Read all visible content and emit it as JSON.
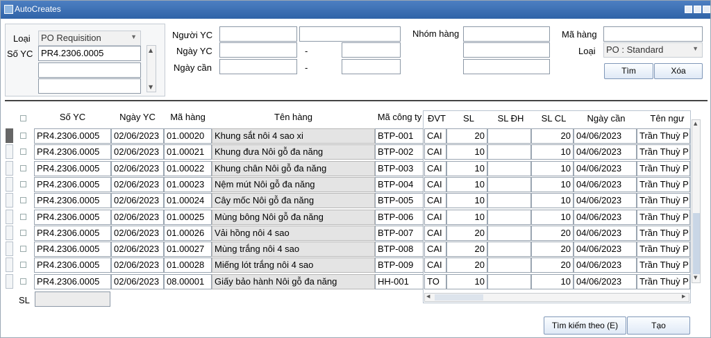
{
  "window": {
    "title": "AutoCreates"
  },
  "search": {
    "loai_label": "Loại",
    "loai_value": "PO Requisition",
    "so_yc_label": "Số YC",
    "so_yc_value": "PR4.2306.0005",
    "nguoi_yc_label": "Người YC",
    "ngay_yc_label": "Ngày YC",
    "ngay_can_label": "Ngày cần",
    "dash": "-",
    "nhom_hang_label": "Nhóm hàng",
    "ma_hang_label": "Mã hàng",
    "loai2_label": "Loại",
    "loai2_value": "PO : Standard",
    "tim_label": "Tìm",
    "xoa_label": "Xóa"
  },
  "table": {
    "columns": [
      "Số YC",
      "Ngày YC",
      "Mã hàng",
      "Tên hàng",
      "Mã công ty",
      "ĐVT",
      "SL",
      "SL ĐH",
      "SL CL",
      "Ngày cần",
      "Tên ngư"
    ],
    "rows": [
      {
        "so_yc": "PR4.2306.0005",
        "ngay_yc": "02/06/2023",
        "ma_hang": "01.00020",
        "ten_hang": "Khung sắt nôi 4 sao xi",
        "ma_cty": "BTP-001",
        "dvt": "CAI",
        "sl": "20",
        "sl_dh": "",
        "sl_cl": "20",
        "ngay_can": "04/06/2023",
        "ten_ngu": "Trần Thuỳ P"
      },
      {
        "so_yc": "PR4.2306.0005",
        "ngay_yc": "02/06/2023",
        "ma_hang": "01.00021",
        "ten_hang": "Khung đưa Nôi gỗ đa năng",
        "ma_cty": "BTP-002",
        "dvt": "CAI",
        "sl": "10",
        "sl_dh": "",
        "sl_cl": "10",
        "ngay_can": "04/06/2023",
        "ten_ngu": "Trần Thuỳ P"
      },
      {
        "so_yc": "PR4.2306.0005",
        "ngay_yc": "02/06/2023",
        "ma_hang": "01.00022",
        "ten_hang": "Khung chân Nôi gỗ đa năng",
        "ma_cty": "BTP-003",
        "dvt": "CAI",
        "sl": "10",
        "sl_dh": "",
        "sl_cl": "10",
        "ngay_can": "04/06/2023",
        "ten_ngu": "Trần Thuỳ P"
      },
      {
        "so_yc": "PR4.2306.0005",
        "ngay_yc": "02/06/2023",
        "ma_hang": "01.00023",
        "ten_hang": "Nệm mút Nôi gỗ đa năng",
        "ma_cty": "BTP-004",
        "dvt": "CAI",
        "sl": "10",
        "sl_dh": "",
        "sl_cl": "10",
        "ngay_can": "04/06/2023",
        "ten_ngu": "Trần Thuỳ P"
      },
      {
        "so_yc": "PR4.2306.0005",
        "ngay_yc": "02/06/2023",
        "ma_hang": "01.00024",
        "ten_hang": "Cây mốc Nôi gỗ đa năng",
        "ma_cty": "BTP-005",
        "dvt": "CAI",
        "sl": "10",
        "sl_dh": "",
        "sl_cl": "10",
        "ngay_can": "04/06/2023",
        "ten_ngu": "Trần Thuỳ P"
      },
      {
        "so_yc": "PR4.2306.0005",
        "ngay_yc": "02/06/2023",
        "ma_hang": "01.00025",
        "ten_hang": "Mùng bông Nôi gỗ đa năng",
        "ma_cty": "BTP-006",
        "dvt": "CAI",
        "sl": "10",
        "sl_dh": "",
        "sl_cl": "10",
        "ngay_can": "04/06/2023",
        "ten_ngu": "Trần Thuỳ P"
      },
      {
        "so_yc": "PR4.2306.0005",
        "ngay_yc": "02/06/2023",
        "ma_hang": "01.00026",
        "ten_hang": "Vải hồng nôi 4 sao",
        "ma_cty": "BTP-007",
        "dvt": "CAI",
        "sl": "20",
        "sl_dh": "",
        "sl_cl": "20",
        "ngay_can": "04/06/2023",
        "ten_ngu": "Trần Thuỳ P"
      },
      {
        "so_yc": "PR4.2306.0005",
        "ngay_yc": "02/06/2023",
        "ma_hang": "01.00027",
        "ten_hang": "Mùng trắng nôi 4 sao",
        "ma_cty": "BTP-008",
        "dvt": "CAI",
        "sl": "20",
        "sl_dh": "",
        "sl_cl": "20",
        "ngay_can": "04/06/2023",
        "ten_ngu": "Trần Thuỳ P"
      },
      {
        "so_yc": "PR4.2306.0005",
        "ngay_yc": "02/06/2023",
        "ma_hang": "01.00028",
        "ten_hang": "Miếng lót trắng nôi 4 sao",
        "ma_cty": "BTP-009",
        "dvt": "CAI",
        "sl": "20",
        "sl_dh": "",
        "sl_cl": "20",
        "ngay_can": "04/06/2023",
        "ten_ngu": "Trần Thuỳ P"
      },
      {
        "so_yc": "PR4.2306.0005",
        "ngay_yc": "02/06/2023",
        "ma_hang": "08.00001",
        "ten_hang": "Giấy bảo hành Nôi gỗ đa năng",
        "ma_cty": "HH-001",
        "dvt": "TO",
        "sl": "10",
        "sl_dh": "",
        "sl_cl": "10",
        "ngay_can": "04/06/2023",
        "ten_ngu": "Trần Thuỳ P"
      }
    ]
  },
  "footer": {
    "sl_label": "SL",
    "search_by_label": "Tìm kiếm theo (E)",
    "create_label": "Tạo"
  }
}
